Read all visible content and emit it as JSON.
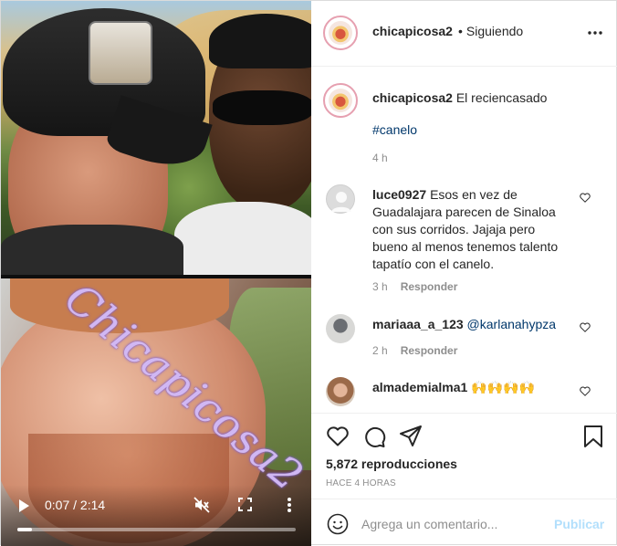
{
  "video": {
    "watermark": "Chicapicosa2",
    "time": "0:07 / 2:14",
    "progress": 0.052,
    "icons": [
      "play-icon",
      "mute-icon",
      "fullscreen-icon",
      "more-vertical-icon"
    ]
  },
  "header": {
    "username": "chicapicosa2",
    "separator": "•",
    "follow_status": "Siguiendo",
    "more_icon": "more-horizontal-icon"
  },
  "caption": {
    "username": "chicapicosa2",
    "text": "El reciencasado",
    "hashtag": "#canelo",
    "time": "4 h"
  },
  "comments": [
    {
      "username": "luce0927",
      "text": "Esos en vez de Guadalajara parecen de Sinaloa con sus corridos. Jajaja pero bueno al menos tenemos talento tapatío con el canelo.",
      "time": "3 h",
      "reply": "Responder"
    },
    {
      "username": "mariaaa_a_123",
      "mention": "@karlanahypza",
      "time": "2 h",
      "reply": "Responder"
    },
    {
      "username": "almademialma1",
      "text": "🙌🙌🙌🙌"
    }
  ],
  "actions": {
    "icons": [
      "heart-icon",
      "comment-icon",
      "share-icon",
      "bookmark-icon"
    ],
    "views": "5,872 reproducciones",
    "posted": "HACE 4 HORAS"
  },
  "add_comment": {
    "placeholder": "Agrega un comentario...",
    "publish": "Publicar"
  },
  "colors": {
    "link": "#00376b",
    "muted": "#8e8e8e",
    "publish_disabled": "#b2dffc",
    "border": "#efefef"
  }
}
